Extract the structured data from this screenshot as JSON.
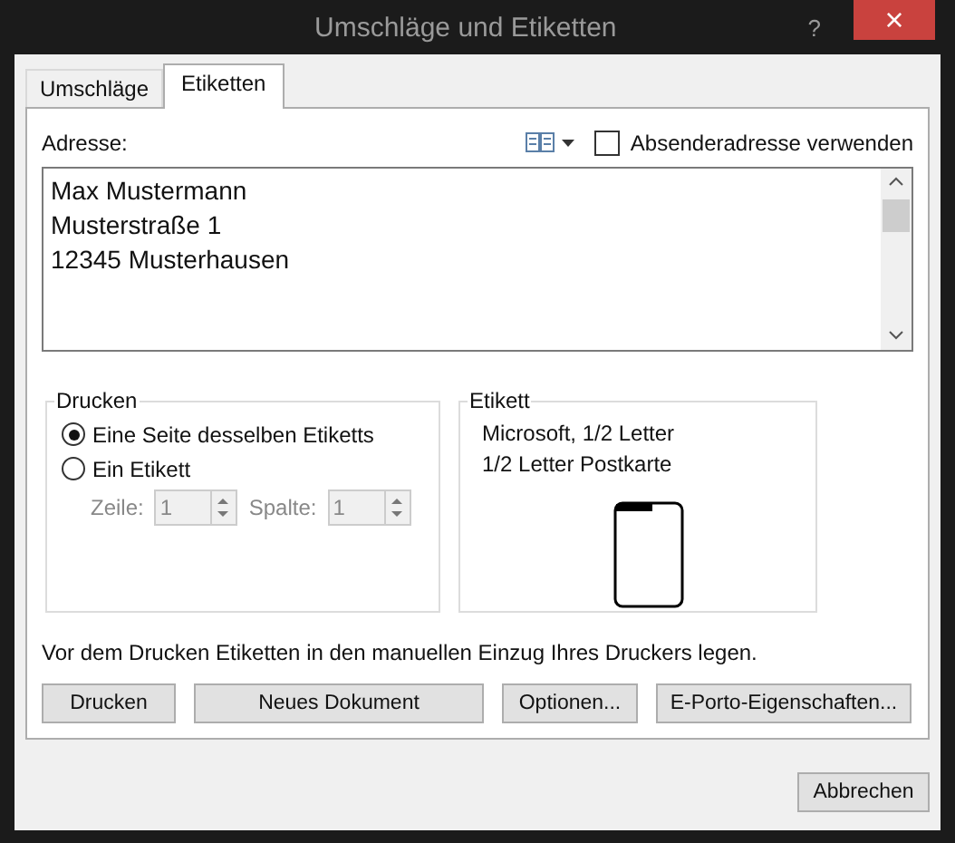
{
  "window": {
    "title": "Umschläge und Etiketten",
    "help": "?",
    "close": "×"
  },
  "tabs": [
    {
      "label": "Umschläge",
      "selected": false
    },
    {
      "label": "Etiketten",
      "selected": true
    }
  ],
  "address": {
    "label": "Adresse:",
    "lines": [
      "Max Mustermann",
      "Musterstraße 1",
      "12345 Musterhausen"
    ]
  },
  "sender_checkbox": {
    "label": "Absenderadresse verwenden",
    "checked": false
  },
  "print_group": {
    "title": "Drucken",
    "options": [
      {
        "label": "Eine Seite desselben Etiketts",
        "selected": true
      },
      {
        "label": "Ein Etikett",
        "selected": false
      }
    ],
    "spinners": [
      {
        "label": "Zeile:",
        "value": "1",
        "disabled": true
      },
      {
        "label": "Spalte:",
        "value": "1",
        "disabled": true
      }
    ]
  },
  "label_group": {
    "title": "Etikett",
    "lines": [
      "Microsoft, 1/2 Letter",
      "1/2 Letter Postkarte"
    ]
  },
  "note": "Vor dem Drucken Etiketten in den manuellen Einzug Ihres Druckers legen.",
  "buttons": [
    "Drucken",
    "Neues Dokument",
    "Optionen...",
    "E-Porto-Eigenschaften..."
  ],
  "cancel": "Abbrechen"
}
